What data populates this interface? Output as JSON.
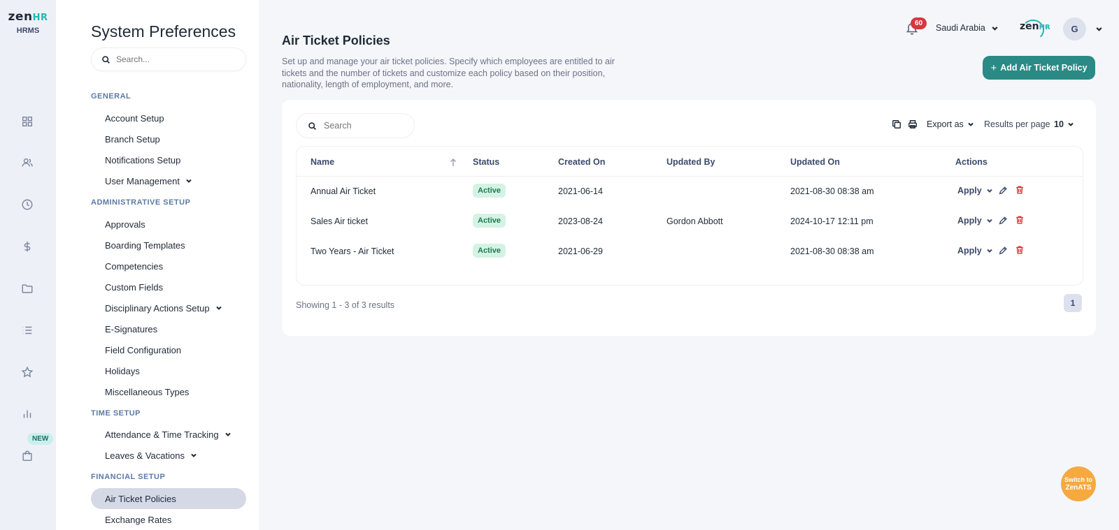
{
  "brand": {
    "logo_main": "zen",
    "logo_accent": "HR",
    "logo_sub": "HRMS"
  },
  "rail": {
    "icons": [
      "dashboard-icon",
      "people-icon",
      "clock-icon",
      "dollar-icon",
      "folder-icon",
      "list-icon",
      "star-icon",
      "chart-icon",
      "bag-icon"
    ],
    "new_badge": "NEW"
  },
  "sidebar": {
    "title": "System Preferences",
    "search_placeholder": "Search...",
    "sections": {
      "general": "GENERAL",
      "admin": "ADMINISTRATIVE SETUP",
      "time": "TIME SETUP",
      "financial": "FINANCIAL SETUP"
    },
    "items": {
      "account_setup": "Account Setup",
      "branch_setup": "Branch Setup",
      "notifications_setup": "Notifications Setup",
      "user_management": "User Management",
      "approvals": "Approvals",
      "boarding_templates": "Boarding Templates",
      "competencies": "Competencies",
      "custom_fields": "Custom Fields",
      "disciplinary_actions": "Disciplinary Actions Setup",
      "e_signatures": "E-Signatures",
      "field_configuration": "Field Configuration",
      "holidays": "Holidays",
      "misc_types": "Miscellaneous Types",
      "attendance": "Attendance & Time Tracking",
      "leaves": "Leaves & Vacations",
      "air_ticket": "Air Ticket Policies",
      "exchange_rates": "Exchange Rates"
    }
  },
  "header": {
    "notifications_count": "60",
    "country": "Saudi Arabia",
    "logo_main": "zen",
    "logo_accent": "HR",
    "avatar_initial": "G"
  },
  "main": {
    "title": "Air Ticket Policies",
    "description": "Set up and manage your air ticket policies. Specify which employees are entitled to air tickets and the number of tickets and customize each policy based on their position, nationality, length of employment, and more.",
    "add_button": "Add Air Ticket Policy",
    "add_button_plus": "+"
  },
  "table_tools": {
    "search_placeholder": "Search",
    "export_label": "Export as",
    "rpp_label": "Results per page",
    "rpp_value": "10"
  },
  "table": {
    "columns": {
      "name": "Name",
      "status": "Status",
      "created_on": "Created On",
      "updated_by": "Updated By",
      "updated_on": "Updated On",
      "actions": "Actions"
    },
    "rows": [
      {
        "name": "Annual Air Ticket",
        "status": "Active",
        "created_on": "2021-06-14",
        "updated_by": "",
        "updated_on": "2021-08-30 08:38 am",
        "action": "Apply"
      },
      {
        "name": "Sales Air ticket",
        "status": "Active",
        "created_on": "2023-08-24",
        "updated_by": "Gordon Abbott",
        "updated_on": "2024-10-17 12:11 pm",
        "action": "Apply"
      },
      {
        "name": "Two Years - Air Ticket",
        "status": "Active",
        "created_on": "2021-06-29",
        "updated_by": "",
        "updated_on": "2021-08-30 08:38 am",
        "action": "Apply"
      }
    ]
  },
  "pagination": {
    "showing": "Showing 1 - 3 of 3 results",
    "current_page": "1"
  },
  "switch_ats": {
    "line1": "Switch to",
    "line2": "ZenATS"
  },
  "colors": {
    "accent": "#2a8a85",
    "brand_teal": "#2ab3b1",
    "danger": "#d9363e",
    "active_badge_bg": "#d4f3e5",
    "switch_button": "#f5a93f"
  }
}
